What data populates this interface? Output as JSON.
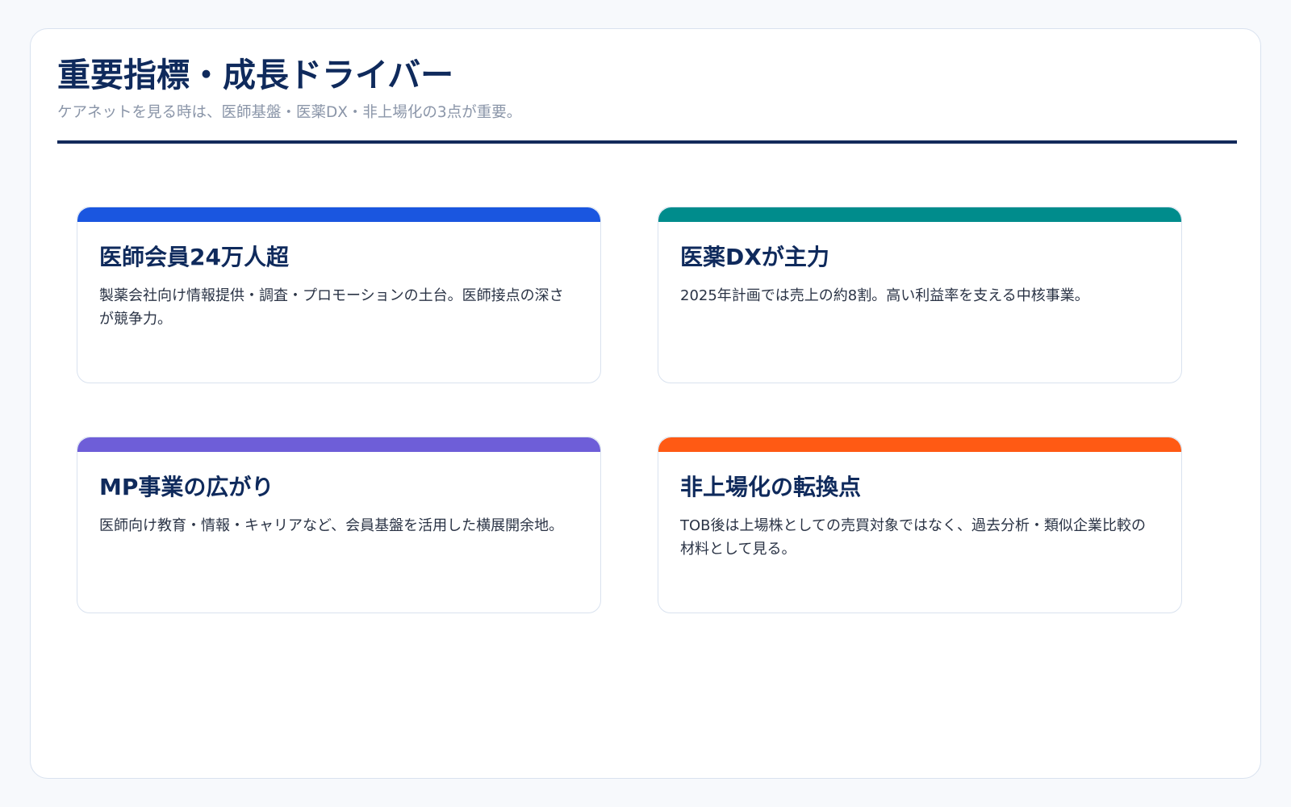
{
  "header": {
    "title": "重要指標・成長ドライバー",
    "subtitle": "ケアネットを見る時は、医師基盤・医薬DX・非上場化の3点が重要。"
  },
  "cards": [
    {
      "title": "医師会員24万人超",
      "text": "製薬会社向け情報提供・調査・プロモーションの土台。医師接点の深さが競争力。",
      "accent": "#1a56e0"
    },
    {
      "title": "医薬DXが主力",
      "text": "2025年計画では売上の約8割。高い利益率を支える中核事業。",
      "accent": "#008c8c"
    },
    {
      "title": "MP事業の広がり",
      "text": "医師向け教育・情報・キャリアなど、会員基盤を活用した横展開余地。",
      "accent": "#6e5ed8"
    },
    {
      "title": "非上場化の転換点",
      "text": "TOB後は上場株としての売買対象ではなく、過去分析・類似企業比較の材料として見る。",
      "accent": "#ff5a14"
    }
  ],
  "colors": {
    "title": "#0f2a5c",
    "subtitle": "#8a95a8",
    "rule": "#132a5b",
    "background": "#f7f9fc"
  }
}
